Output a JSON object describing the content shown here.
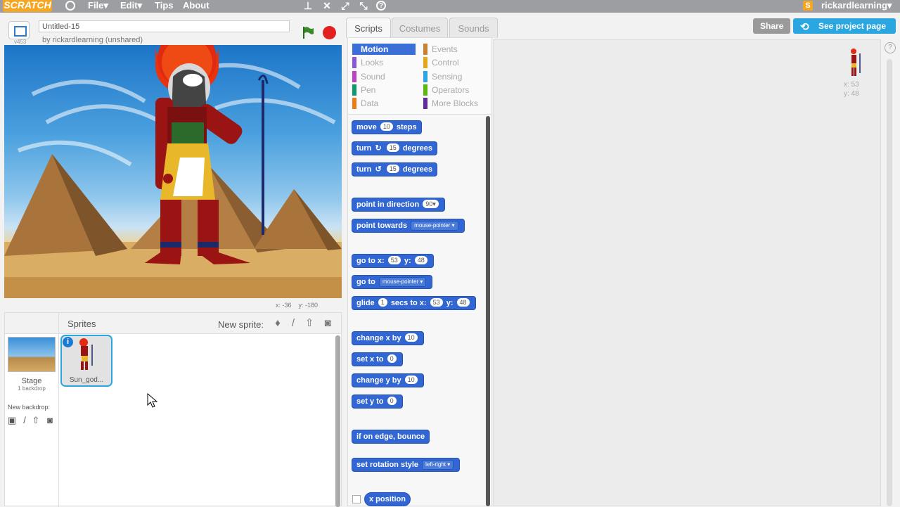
{
  "menubar": {
    "logo": "SCRATCH",
    "file": "File▾",
    "edit": "Edit▾",
    "tips": "Tips",
    "about": "About",
    "username": "rickardlearning▾",
    "user_badge": "S"
  },
  "project": {
    "version": "v453",
    "title": "Untitled-15",
    "byline": "by rickardlearning (unshared)"
  },
  "stage": {
    "mouse_x_label": "x: -36",
    "mouse_y_label": "y: -180"
  },
  "sprites_pane": {
    "title": "Sprites",
    "new_sprite": "New sprite:",
    "stage_label": "Stage",
    "stage_backdrops": "1 backdrop",
    "new_backdrop": "New backdrop:",
    "sprite_name": "Sun_god...",
    "info_badge": "i"
  },
  "tabs": [
    "Scripts",
    "Costumes",
    "Sounds"
  ],
  "buttons": {
    "share": "Share",
    "see_project": "See project page"
  },
  "categories": [
    {
      "label": "Motion",
      "color": "#4a6cd4"
    },
    {
      "label": "Looks",
      "color": "#8a55d7"
    },
    {
      "label": "Sound",
      "color": "#bb42c3"
    },
    {
      "label": "Pen",
      "color": "#0e9a6c"
    },
    {
      "label": "Data",
      "color": "#ee7d16"
    },
    {
      "label": "Events",
      "color": "#c88330"
    },
    {
      "label": "Control",
      "color": "#e1a91a"
    },
    {
      "label": "Sensing",
      "color": "#2ca5e2"
    },
    {
      "label": "Operators",
      "color": "#5cb712"
    },
    {
      "label": "More Blocks",
      "color": "#632d99"
    }
  ],
  "blocks": {
    "move": {
      "a": "move",
      "n": "10",
      "b": "steps"
    },
    "turn_right": {
      "a": "turn",
      "n": "15",
      "b": "degrees"
    },
    "turn_left": {
      "a": "turn",
      "n": "15",
      "b": "degrees"
    },
    "point_dir": {
      "a": "point in direction",
      "n": "90▾"
    },
    "point_towards": {
      "a": "point towards",
      "d": "mouse-pointer"
    },
    "go_to_xy": {
      "a": "go to x:",
      "x": "53",
      "b": "y:",
      "y": "48"
    },
    "go_to": {
      "a": "go to",
      "d": "mouse-pointer"
    },
    "glide": {
      "a": "glide",
      "n": "1",
      "b": "secs to x:",
      "x": "53",
      "c": "y:",
      "y": "48"
    },
    "change_x": {
      "a": "change x by",
      "n": "10"
    },
    "set_x": {
      "a": "set x to",
      "n": "0"
    },
    "change_y": {
      "a": "change y by",
      "n": "10"
    },
    "set_y": {
      "a": "set y to",
      "n": "0"
    },
    "bounce": {
      "a": "if on edge, bounce"
    },
    "rotation": {
      "a": "set rotation style",
      "d": "left-right"
    },
    "x_position": {
      "a": "x position"
    }
  },
  "current_sprite": {
    "x_label": "x: 53",
    "y_label": "y: 48"
  },
  "colors": {
    "motion_block": "#3266d3",
    "menubar": "#9c9ea2",
    "accent": "#2aa6e0",
    "stop": "#e32020",
    "flag": "#3a8a2a"
  },
  "icons": [
    "globe-icon",
    "stamp-icon",
    "grow-icon",
    "shrink-icon",
    "help-icon",
    "fullscreen-icon",
    "green-flag-icon",
    "stop-icon",
    "paint-icon",
    "upload-icon",
    "camera-icon"
  ]
}
